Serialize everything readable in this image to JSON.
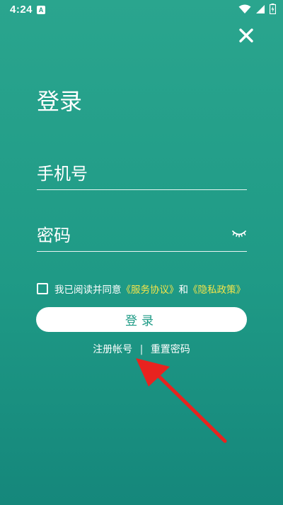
{
  "status_bar": {
    "time": "4:24",
    "app_icon_letter": "A",
    "icons": [
      "wifi-icon",
      "signal-icon",
      "battery-icon"
    ]
  },
  "header": {
    "close_icon": "close-icon"
  },
  "page": {
    "title": "登录"
  },
  "form": {
    "phone_placeholder": "手机号",
    "password_placeholder": "密码",
    "password_toggle_icon": "eye-closed-icon"
  },
  "agreement": {
    "checked": false,
    "prefix": "我已阅读并同意",
    "service_link": "《服务协议》",
    "and": "和",
    "privacy_link": "《隐私政策》"
  },
  "actions": {
    "login_label": "登录",
    "register_label": "注册帐号",
    "separator": "|",
    "reset_label": "重置密码"
  },
  "colors": {
    "bg_top": "#2aa58e",
    "bg_bottom": "#15877b",
    "link_yellow": "#f4e44a",
    "button_text": "#1c9a85",
    "annotation_arrow": "#e8231f"
  }
}
